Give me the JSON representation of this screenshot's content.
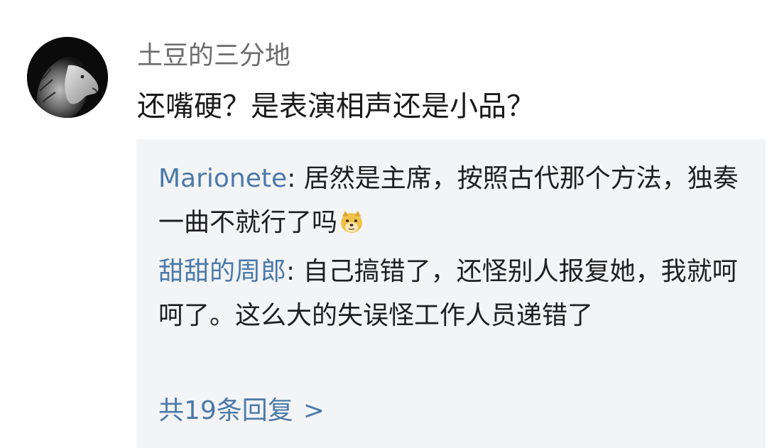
{
  "comment": {
    "username": "土豆的三分地",
    "text": "还嘴硬？是表演相声还是小品？",
    "avatar_icon": "lion-avatar"
  },
  "replies": [
    {
      "name": "Marionete",
      "separator": ": ",
      "text": "居然是主席，按照古代那个方法，独奏一曲不就行了吗",
      "emoji": "doge-emoji"
    },
    {
      "name": "甜甜的周郎",
      "separator": ": ",
      "text": "自己搞错了，还怪别人报复她，我就呵呵了。这么大的失误怪工作人员递错了"
    }
  ],
  "more_replies": {
    "label": "共19条回复",
    "chevron": ">"
  },
  "colors": {
    "link": "#4b79a9",
    "reply_background": "#f3f4f6",
    "username": "#6b6b6b",
    "text": "#1a1a1a"
  }
}
